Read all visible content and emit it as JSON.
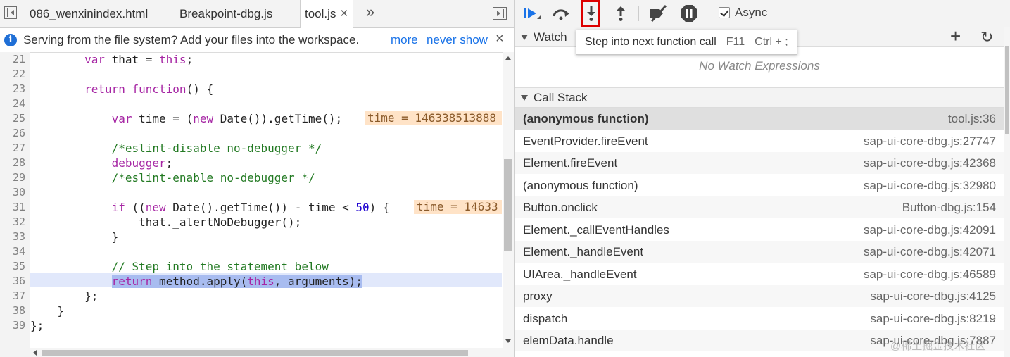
{
  "tabs": {
    "items": [
      {
        "label": "086_wenxinindex.html"
      },
      {
        "label": "Breakpoint-dbg.js"
      },
      {
        "label": "tool.js"
      }
    ],
    "more": "»"
  },
  "infobar": {
    "message": "Serving from the file system? Add your files into the workspace.",
    "more_link": "more",
    "never_show_link": "never show",
    "close": "×"
  },
  "code": {
    "line_numbers": [
      "21",
      "22",
      "23",
      "24",
      "25",
      "26",
      "27",
      "28",
      "29",
      "30",
      "31",
      "32",
      "33",
      "34",
      "35",
      "36",
      "37",
      "38",
      "39"
    ],
    "inline_values": [
      "time = 146338513888",
      "time = 14633"
    ],
    "execution_line": "36"
  },
  "debug_toolbar": {
    "async_label": "Async",
    "async_checked": true
  },
  "tooltip": {
    "text": "Step into next function call",
    "shortcut_1": "F11",
    "shortcut_2": "Ctrl + ;"
  },
  "watch": {
    "title": "Watch",
    "add": "+",
    "refresh": "↻",
    "empty": "No Watch Expressions"
  },
  "call_stack": {
    "title": "Call Stack",
    "frames": [
      {
        "name": "(anonymous function)",
        "location": "tool.js:36"
      },
      {
        "name": "EventProvider.fireEvent",
        "location": "sap-ui-core-dbg.js:27747"
      },
      {
        "name": "Element.fireEvent",
        "location": "sap-ui-core-dbg.js:42368"
      },
      {
        "name": "(anonymous function)",
        "location": "sap-ui-core-dbg.js:32980"
      },
      {
        "name": "Button.onclick",
        "location": "Button-dbg.js:154"
      },
      {
        "name": "Element._callEventHandles",
        "location": "sap-ui-core-dbg.js:42091"
      },
      {
        "name": "Element._handleEvent",
        "location": "sap-ui-core-dbg.js:42071"
      },
      {
        "name": "UIArea._handleEvent",
        "location": "sap-ui-core-dbg.js:46589"
      },
      {
        "name": "proxy",
        "location": "sap-ui-core-dbg.js:4125"
      },
      {
        "name": "dispatch",
        "location": "sap-ui-core-dbg.js:8219"
      },
      {
        "name": "elemData.handle",
        "location": "sap-ui-core-dbg.js:7887"
      }
    ]
  },
  "watermark": "@稀土掘金技术社区"
}
